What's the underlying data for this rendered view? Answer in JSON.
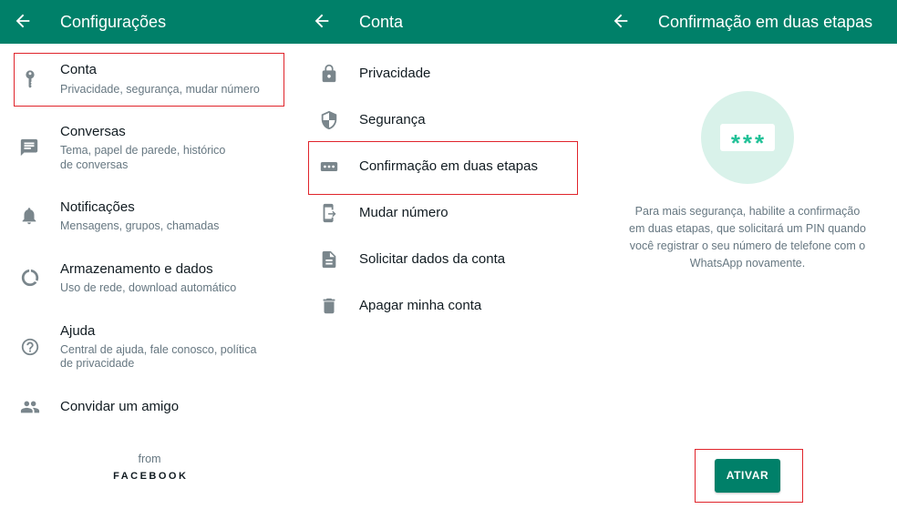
{
  "colors": {
    "header": "#008069",
    "header_text": "#ffffff",
    "title_text": "#111b21",
    "subtitle_text": "#667781",
    "icon": "#7a868c",
    "highlight_border": "#e0242b",
    "accent": "#008069",
    "illustration_bg": "#d9f2ea",
    "pin_asterisks": "#21c197"
  },
  "settings_screen": {
    "title": "Configurações",
    "back_icon": "arrow-back-icon",
    "items": [
      {
        "icon": "key-icon",
        "title": "Conta",
        "subtitle": [
          "Privacidade, segurança, mudar número"
        ],
        "highlighted": true
      },
      {
        "icon": "chat-icon",
        "title": "Conversas",
        "subtitle": [
          "Tema, papel de parede, histórico",
          "de conversas"
        ]
      },
      {
        "icon": "bell-icon",
        "title": "Notificações",
        "subtitle": [
          "Mensagens, grupos, chamadas"
        ]
      },
      {
        "icon": "data-usage-icon",
        "title": "Armazenamento e dados",
        "subtitle": [
          "Uso de rede, download automático"
        ]
      },
      {
        "icon": "help-icon",
        "title": "Ajuda",
        "subtitle": [
          "Central de ajuda, fale conosco, política",
          "de privacidade"
        ]
      },
      {
        "icon": "people-icon",
        "title": "Convidar um amigo"
      }
    ],
    "footer": {
      "from": "from",
      "brand": "FACEBOOK"
    }
  },
  "account_screen": {
    "title": "Conta",
    "back_icon": "arrow-back-icon",
    "items": [
      {
        "icon": "lock-icon",
        "title": "Privacidade"
      },
      {
        "icon": "shield-icon",
        "title": "Segurança"
      },
      {
        "icon": "password-dots-icon",
        "title": "Confirmação em duas etapas",
        "highlighted": true
      },
      {
        "icon": "phone-change-icon",
        "title": "Mudar número"
      },
      {
        "icon": "document-icon",
        "title": "Solicitar dados da conta"
      },
      {
        "icon": "trash-icon",
        "title": "Apagar minha conta"
      }
    ]
  },
  "two_step_screen": {
    "title": "Confirmação em duas etapas",
    "back_icon": "arrow-back-icon",
    "pin_placeholder": "***",
    "description": [
      "Para mais segurança, habilite a confirmação",
      "em duas etapas, que solicitará um PIN quando",
      "você registrar o seu número de telefone com o",
      "WhatsApp novamente."
    ],
    "button_label": "ATIVAR",
    "button_highlighted": true
  }
}
